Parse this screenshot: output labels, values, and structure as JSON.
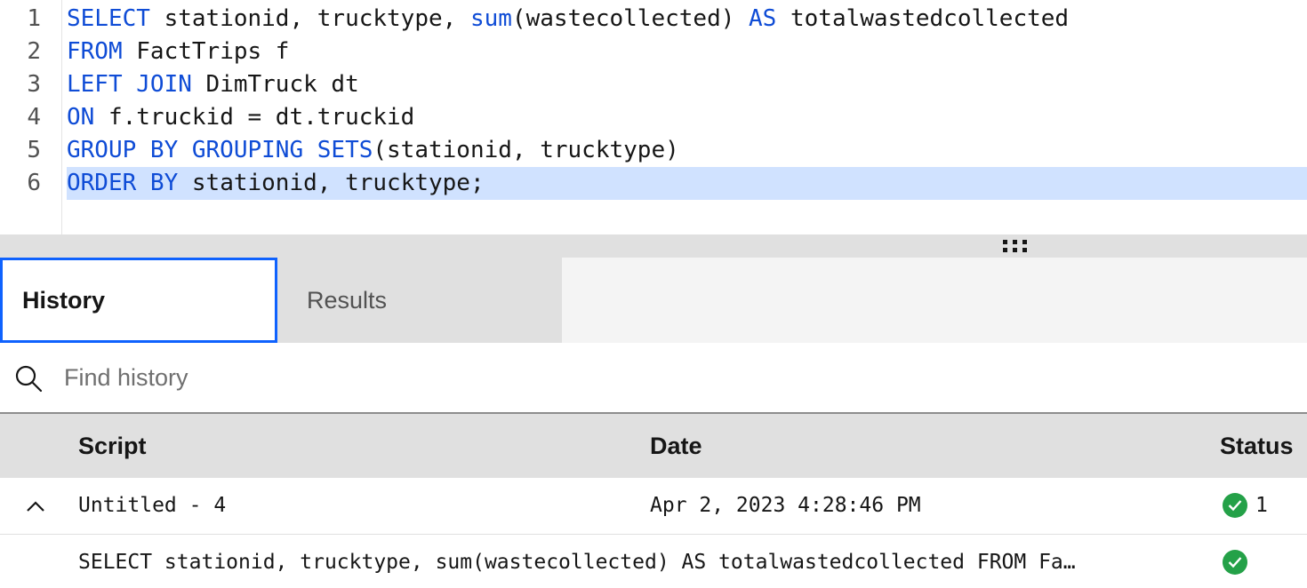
{
  "editor": {
    "lines": [
      {
        "number": "1",
        "tokens": [
          {
            "t": "SELECT",
            "k": "kw"
          },
          {
            "t": " stationid, trucktype, ",
            "k": ""
          },
          {
            "t": "sum",
            "k": "fn"
          },
          {
            "t": "(wastecollected) ",
            "k": ""
          },
          {
            "t": "AS",
            "k": "kw"
          },
          {
            "t": " totalwastedcollected",
            "k": ""
          }
        ]
      },
      {
        "number": "2",
        "tokens": [
          {
            "t": "FROM",
            "k": "kw"
          },
          {
            "t": " FactTrips f",
            "k": ""
          }
        ]
      },
      {
        "number": "3",
        "tokens": [
          {
            "t": "LEFT JOIN",
            "k": "kw"
          },
          {
            "t": " DimTruck dt",
            "k": ""
          }
        ]
      },
      {
        "number": "4",
        "tokens": [
          {
            "t": "ON",
            "k": "kw"
          },
          {
            "t": " f.truckid = dt.truckid",
            "k": ""
          }
        ]
      },
      {
        "number": "5",
        "tokens": [
          {
            "t": "GROUP BY GROUPING SETS",
            "k": "kw"
          },
          {
            "t": "(stationid, trucktype)",
            "k": ""
          }
        ]
      },
      {
        "number": "6",
        "tokens": [
          {
            "t": "ORDER BY",
            "k": "kw"
          },
          {
            "t": " stationid, trucktype;",
            "k": ""
          }
        ]
      }
    ],
    "active_line": "6"
  },
  "tabs": {
    "history": "History",
    "results": "Results",
    "selected": "History"
  },
  "search": {
    "placeholder": "Find history",
    "value": ""
  },
  "table": {
    "headers": {
      "script": "Script",
      "date": "Date",
      "status": "Status"
    },
    "group": {
      "script": "Untitled - 4",
      "date": "Apr 2, 2023 4:28:46 PM",
      "status_count": "1",
      "expanded": true
    },
    "entries": [
      {
        "script": "SELECT stationid, trucktype, sum(wastecollected) AS totalwastedcollected FROM Fa…"
      }
    ]
  },
  "colors": {
    "keyword": "#0f4cd6",
    "active_line": "#d0e2ff",
    "tab_focus": "#0f62fe",
    "success": "#24a148"
  },
  "icons": {
    "search": "search-icon",
    "chevron": "chevron-up-icon",
    "status": "checkmark-filled-icon",
    "grip": "drag-handle-icon"
  }
}
